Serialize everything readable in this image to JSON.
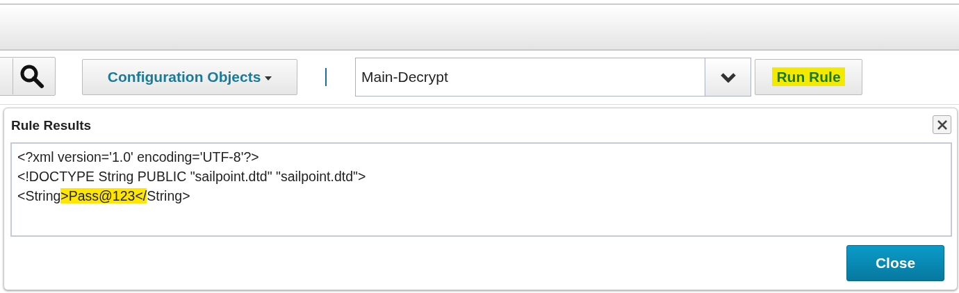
{
  "toolbar": {
    "config_menu": "Configuration Objects",
    "rule_select": {
      "value": "Main-Decrypt"
    },
    "run_button": {
      "label": "Run Rule",
      "highlighted": true
    }
  },
  "dialog": {
    "title": "Rule Results",
    "output_lines": [
      [
        {
          "text": "<?xml version='1.0' encoding='UTF-8'?>",
          "highlighted": false
        }
      ],
      [
        {
          "text": "<!DOCTYPE String PUBLIC \"sailpoint.dtd\" \"sailpoint.dtd\">",
          "highlighted": false
        }
      ],
      [
        {
          "text": "<String",
          "highlighted": false
        },
        {
          "text": ">Pass@123</",
          "highlighted": true
        },
        {
          "text": "String>",
          "highlighted": false
        }
      ]
    ],
    "close_button": "Close"
  }
}
